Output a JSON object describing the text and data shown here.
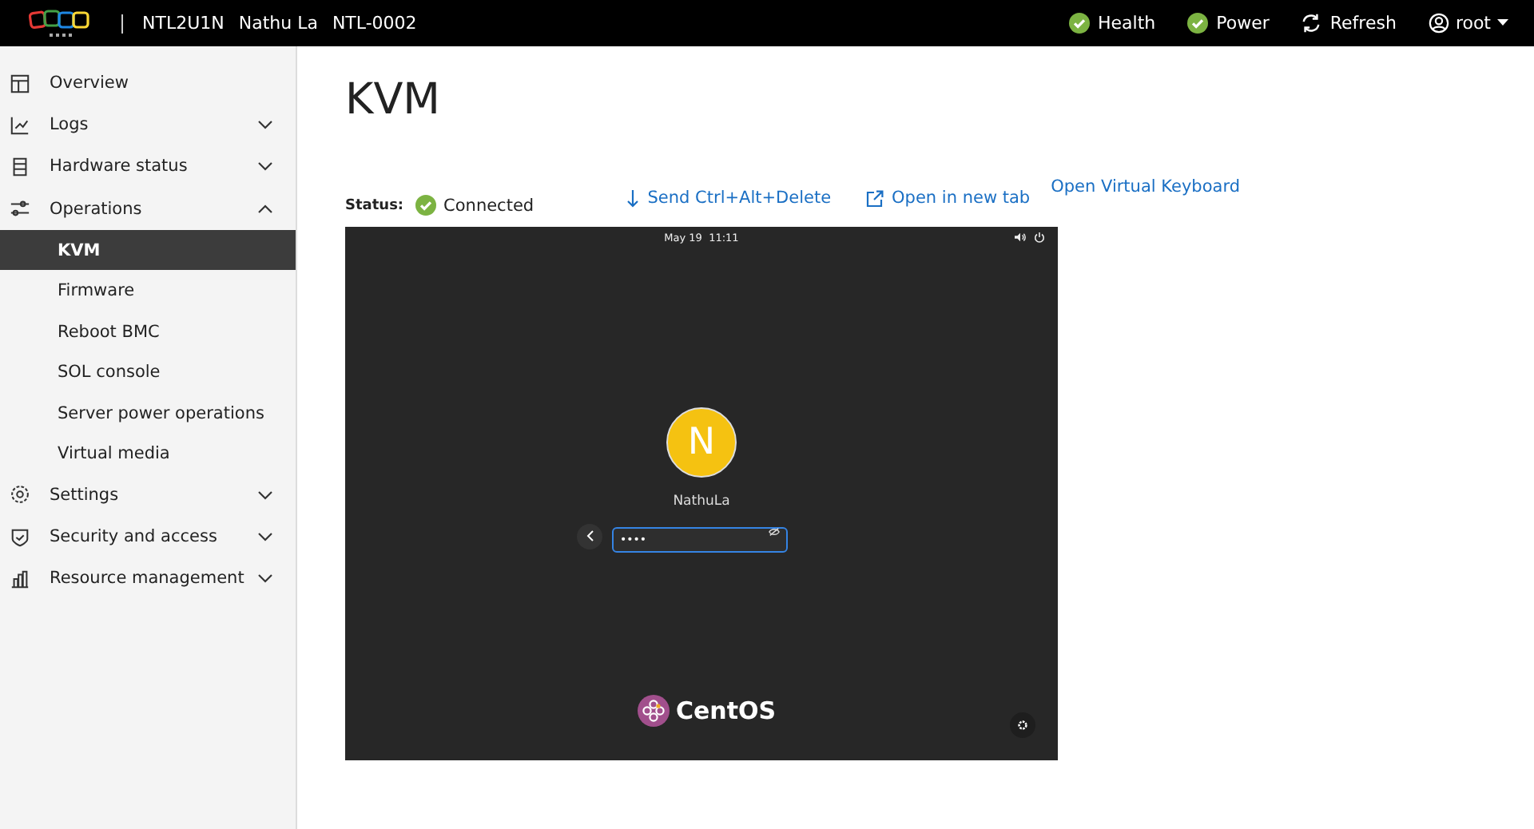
{
  "header": {
    "host_info": [
      "NTL2U1N",
      "Nathu La",
      "NTL-0002"
    ],
    "status": [
      {
        "label": "Health",
        "kind": "ok"
      },
      {
        "label": "Power",
        "kind": "ok"
      },
      {
        "label": "Refresh",
        "kind": "refresh"
      }
    ],
    "user": "root"
  },
  "sidebar": {
    "items": [
      {
        "label": "Overview",
        "kind": "link"
      },
      {
        "label": "Logs",
        "kind": "group",
        "expanded": false
      },
      {
        "label": "Hardware status",
        "kind": "group",
        "expanded": false
      },
      {
        "label": "Operations",
        "kind": "group",
        "expanded": true,
        "children": [
          {
            "label": "KVM",
            "selected": true
          },
          {
            "label": "Firmware",
            "selected": false
          },
          {
            "label": "Reboot BMC",
            "selected": false
          },
          {
            "label": "SOL console",
            "selected": false
          },
          {
            "label": "Server power operations",
            "selected": false
          },
          {
            "label": "Virtual media",
            "selected": false
          }
        ]
      },
      {
        "label": "Settings",
        "kind": "group",
        "expanded": false
      },
      {
        "label": "Security and access",
        "kind": "group",
        "expanded": false
      },
      {
        "label": "Resource management",
        "kind": "group",
        "expanded": false
      }
    ]
  },
  "page": {
    "title": "KVM",
    "status_label": "Status:",
    "status": "Connected",
    "actions": [
      {
        "label": "Send Ctrl+Alt+Delete",
        "kind": "send"
      },
      {
        "label": "Open in new tab",
        "kind": "newtab"
      }
    ],
    "keyboard_link": "Open Virtual Keyboard"
  },
  "console": {
    "clock": "May 19  11:11",
    "avatar_letter": "N",
    "username": "NathuLa",
    "password": "••••",
    "brand": "CentOS"
  }
}
